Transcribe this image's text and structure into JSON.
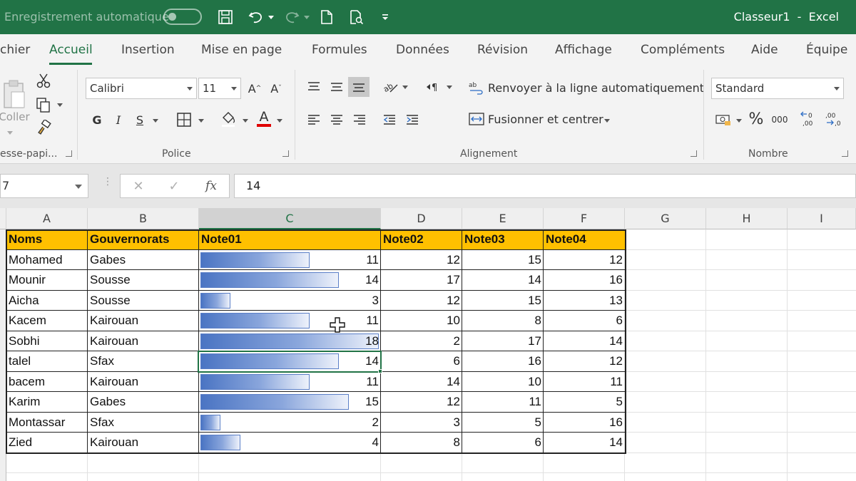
{
  "titlebar": {
    "autosave_label": "Enregistrement automatique",
    "window_title": "Classeur1  -  Excel"
  },
  "tabs": [
    {
      "label": "chier"
    },
    {
      "label": "Accueil"
    },
    {
      "label": "Insertion"
    },
    {
      "label": "Mise en page"
    },
    {
      "label": "Formules"
    },
    {
      "label": "Données"
    },
    {
      "label": "Révision"
    },
    {
      "label": "Affichage"
    },
    {
      "label": "Compléments"
    },
    {
      "label": "Aide"
    },
    {
      "label": "Équipe"
    }
  ],
  "ribbon": {
    "clipboard": {
      "paste_label": "Coller",
      "group_label": "esse-papi..."
    },
    "font": {
      "name": "Calibri",
      "size": "11",
      "bold": "G",
      "italic": "I",
      "underline": "S",
      "group_label": "Police"
    },
    "alignment": {
      "wrap_label": "Renvoyer à la ligne automatiquement",
      "merge_label": "Fusionner et centrer",
      "group_label": "Alignement"
    },
    "number": {
      "format": "Standard",
      "percent": "%",
      "thousands": "000",
      "group_label": "Nombre"
    }
  },
  "formula_bar": {
    "name_box": "7",
    "fx": "fx",
    "value": "14"
  },
  "columns": [
    "A",
    "B",
    "C",
    "D",
    "E",
    "F",
    "G",
    "H",
    "I"
  ],
  "selected_column": "C",
  "table": {
    "headers": [
      "Noms",
      "Gouvernorats",
      "Note01",
      "Note02",
      "Note03",
      "Note04"
    ],
    "rows": [
      {
        "nom": "Mohamed",
        "gouv": "Gabes",
        "n1": "11",
        "n2": "12",
        "n3": "15",
        "n4": "12"
      },
      {
        "nom": "Mounir",
        "gouv": "Sousse",
        "n1": "14",
        "n2": "17",
        "n3": "14",
        "n4": "16"
      },
      {
        "nom": "Aicha",
        "gouv": "Sousse",
        "n1": "3",
        "n2": "12",
        "n3": "15",
        "n4": "13"
      },
      {
        "nom": "Kacem",
        "gouv": "Kairouan",
        "n1": "11",
        "n2": "10",
        "n3": "8",
        "n4": "6"
      },
      {
        "nom": "Sobhi",
        "gouv": "Kairouan",
        "n1": "18",
        "n2": "2",
        "n3": "17",
        "n4": "14"
      },
      {
        "nom": "talel",
        "gouv": "Sfax",
        "n1": "14",
        "n2": "6",
        "n3": "16",
        "n4": "12"
      },
      {
        "nom": "bacem",
        "gouv": "Kairouan",
        "n1": "11",
        "n2": "14",
        "n3": "10",
        "n4": "11"
      },
      {
        "nom": "Karim",
        "gouv": "Gabes",
        "n1": "15",
        "n2": "12",
        "n3": "11",
        "n4": "5"
      },
      {
        "nom": "Montassar",
        "gouv": "Sfax",
        "n1": "2",
        "n2": "3",
        "n3": "5",
        "n4": "16"
      },
      {
        "nom": "Zied",
        "gouv": "Kairouan",
        "n1": "4",
        "n2": "8",
        "n3": "6",
        "n4": "14"
      }
    ]
  },
  "selected_row_index": 5,
  "colors": {
    "excel_green": "#217346",
    "header_fill": "#ffc000",
    "databar": "#4a74c3"
  }
}
